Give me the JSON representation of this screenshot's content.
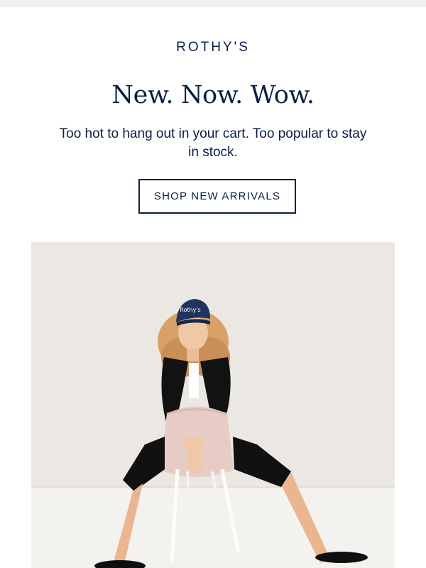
{
  "brand": {
    "logo_text": "ROTHY'S"
  },
  "hero_copy": {
    "headline": "New. Now. Wow.",
    "subhead": "Too hot to hang out in your cart. Too popular to stay in stock."
  },
  "cta": {
    "label": "SHOP NEW ARRIVALS"
  },
  "hero_image": {
    "description": "Model wearing a navy cap and black outfit, seated backwards on a pink chair with white legs",
    "cap_text": "Rothy's"
  },
  "colors": {
    "brand_navy": "#0b1f44",
    "background": "#ffffff",
    "image_bg": "#ece9e4"
  }
}
